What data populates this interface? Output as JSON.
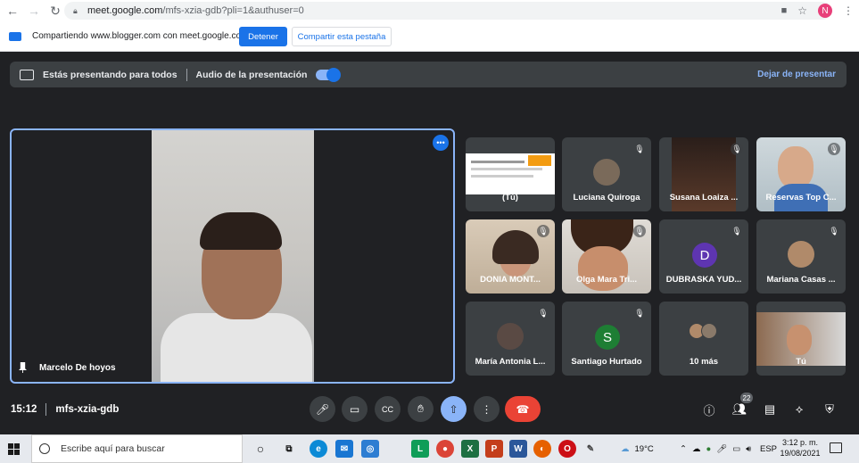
{
  "browser": {
    "url_host": "meet.google.com",
    "url_path": "/mfs-xzia-gdb?pli=1&authuser=0",
    "profile_initial": "N"
  },
  "share_bar": {
    "message": "Compartiendo www.blogger.com con meet.google.com",
    "stop_label": "Detener",
    "share_tab_label": "Compartir esta pestaña"
  },
  "present_bar": {
    "presenting_text": "Estás presentando para todos",
    "audio_label": "Audio de la presentación",
    "stop_presenting_label": "Dejar de presentar",
    "audio_enabled": true
  },
  "main_speaker": {
    "name": "Marcelo De hoyos"
  },
  "participants": [
    {
      "name": "(Tú)",
      "kind": "screen"
    },
    {
      "name": "Luciana Quiroga",
      "kind": "photo",
      "muted": true,
      "color": "#7a6a5a"
    },
    {
      "name": "Susana Loaiza ...",
      "kind": "video-dark",
      "muted": true
    },
    {
      "name": "Reservas Top C...",
      "kind": "video-kid",
      "muted": true
    },
    {
      "name": "DONIA MONT...",
      "kind": "video-woman",
      "muted": true
    },
    {
      "name": "Olga Mara Tri...",
      "kind": "video-kid2",
      "muted": true
    },
    {
      "name": "DUBRASKA YUD...",
      "kind": "letter",
      "letter": "D",
      "color": "#5e35b1",
      "muted": true
    },
    {
      "name": "Mariana Casas ...",
      "kind": "photo",
      "muted": true,
      "color": "#b08a6a"
    },
    {
      "name": "María Antonia L...",
      "kind": "photo",
      "muted": true,
      "color": "#5a4a44"
    },
    {
      "name": "Santiago Hurtado",
      "kind": "letter",
      "letter": "S",
      "color": "#1e7e34",
      "muted": true
    },
    {
      "name": "10 más",
      "kind": "more"
    },
    {
      "name": "Tú",
      "kind": "video-room"
    }
  ],
  "meeting": {
    "time": "15:12",
    "code": "mfs-xzia-gdb",
    "people_count": "22"
  },
  "taskbar": {
    "search_placeholder": "Escribe aquí para buscar",
    "temperature": "19°C",
    "language": "ESP",
    "time": "3:12 p. m.",
    "date": "19/08/2021"
  }
}
